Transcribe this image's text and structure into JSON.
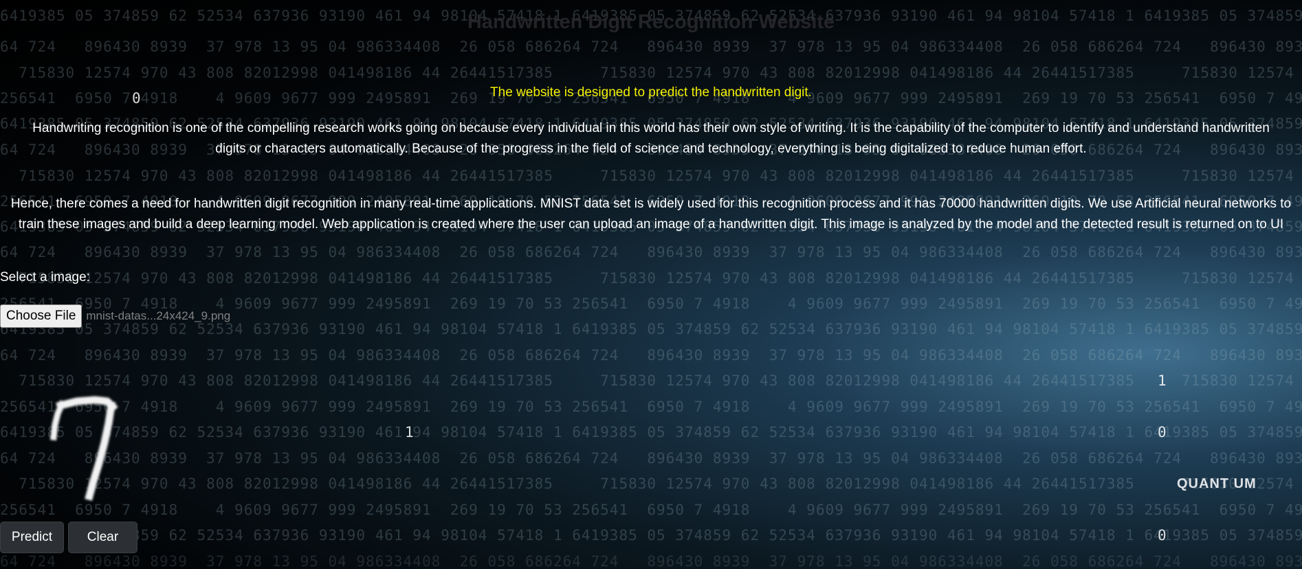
{
  "page": {
    "title": "Handwritten Digit Recognition Website",
    "tagline": "The website is designed to predict the handwritten digit.",
    "paragraph1": "Handwriting recognition is one of the compelling research works going on because every individual in this world has their own style of writing. It is the capability of the computer to identify and understand handwritten digits or characters automatically. Because of the progress in the field of science and technology, everything is being digitalized to reduce human effort.",
    "paragraph2": "Hence, there comes a need for handwritten digit recognition in many real-time applications. MNIST data set is widely used for this recognition process and it has 70000 handwritten digits. We use Artificial neural networks to train these images and build a deep learning model. Web application is created where the user can upload an image of a handwritten digit. This image is analyzed by the model and the detected result is returned on to UI"
  },
  "upload": {
    "label": "Select a image:",
    "choose_button": "Choose File",
    "file_name": "mnist-datas...24x424_9.png"
  },
  "preview": {
    "digit_shown": "7"
  },
  "actions": {
    "predict_label": "Predict",
    "clear_label": "Clear"
  },
  "background": {
    "watermark": "QUANT UM"
  },
  "colors": {
    "tagline": "#f4f000",
    "button_bg": "#2c3034",
    "text": "#ffffff"
  }
}
